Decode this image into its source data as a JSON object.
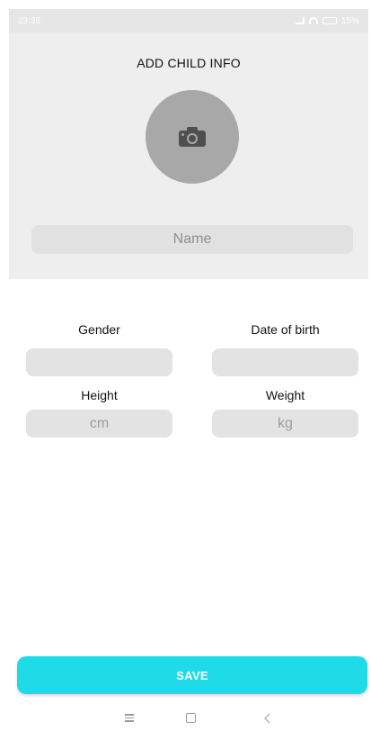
{
  "status_bar": {
    "time": "23:36",
    "battery": "15%"
  },
  "header": {
    "title": "ADD CHILD INFO",
    "photo_icon": "camera-icon"
  },
  "name_field": {
    "placeholder": "Name",
    "value": ""
  },
  "form": {
    "gender_label": "Gender",
    "gender_value": "",
    "dob_label": "Date of birth",
    "dob_value": "",
    "height_label": "Height",
    "height_placeholder": "cm",
    "weight_label": "Weight",
    "weight_placeholder": "kg"
  },
  "save_label": "SAVE",
  "nav_icons": [
    "menu-icon",
    "home-icon",
    "back-icon"
  ],
  "colors": {
    "accent": "#1fdbe8",
    "header_bg": "#eeeeee",
    "field_bg": "#e3e3e3",
    "avatar_bg": "#a8a8a8"
  }
}
